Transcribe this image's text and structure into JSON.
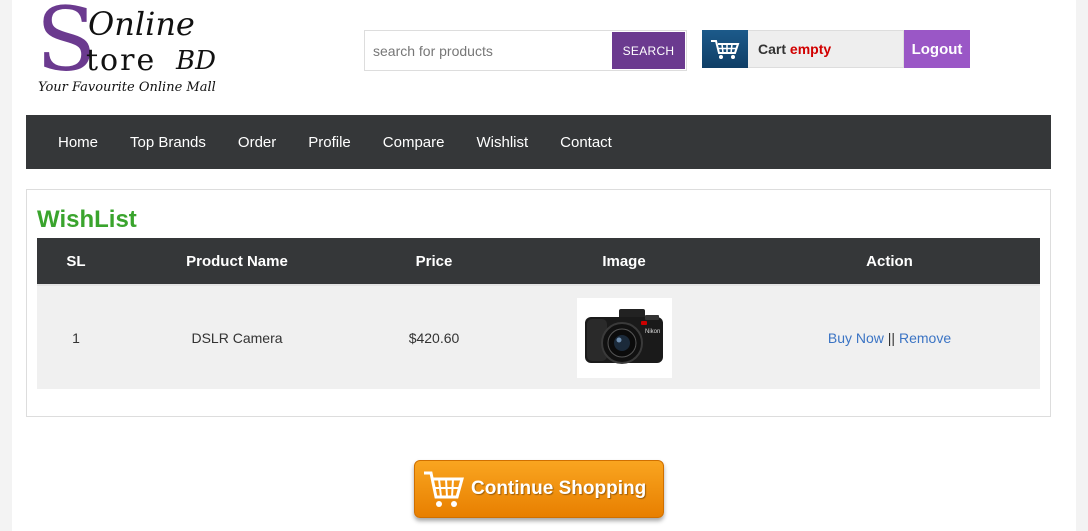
{
  "logo": {
    "s": "S",
    "online": "Online",
    "store": "tore",
    "bd": "BD",
    "tagline": "Your Favourite Online Mall"
  },
  "search": {
    "placeholder": "search for products",
    "button_label": "SEARCH"
  },
  "cart": {
    "label": "Cart",
    "status": "empty",
    "icon": "shopping-cart-icon"
  },
  "logout_label": "Logout",
  "nav": {
    "items": [
      "Home",
      "Top Brands",
      "Order",
      "Profile",
      "Compare",
      "Wishlist",
      "Contact"
    ]
  },
  "wishlist": {
    "title": "WishList",
    "columns": [
      "SL",
      "Product Name",
      "Price",
      "Image",
      "Action"
    ],
    "rows": [
      {
        "sl": "1",
        "name": "DSLR Camera",
        "price": "$420.60",
        "image": "camera-image",
        "buy_label": "Buy Now",
        "separator": "||",
        "remove_label": "Remove"
      }
    ]
  },
  "continue_label": "Continue Shopping",
  "colors": {
    "brand_purple": "#6b3a8f",
    "logout_purple": "#9a57c6",
    "nav_dark": "#353739",
    "wishlist_green": "#3aa42d",
    "link_blue": "#3b74c4",
    "cart_empty_red": "#d10000",
    "continue_orange": "#f39400"
  }
}
